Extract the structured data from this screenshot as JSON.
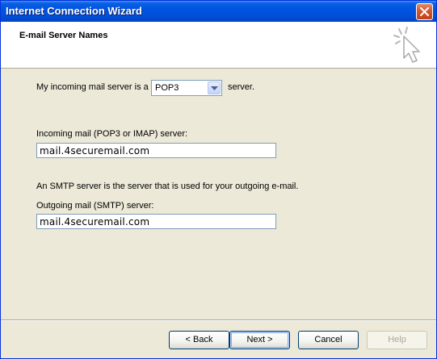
{
  "window": {
    "title": "Internet Connection Wizard",
    "close_icon": "close-icon"
  },
  "header": {
    "heading": "E-mail Server Names",
    "icon": "wizard-sparkle-cursor-icon"
  },
  "form": {
    "incoming_type_prefix": "My incoming mail server is a",
    "incoming_type_value": "POP3",
    "incoming_type_suffix": "server.",
    "incoming_label": "Incoming mail (POP3 or IMAP) server:",
    "incoming_value": "mail.4securemail.com",
    "smtp_note": "An SMTP server is the server that is used for your outgoing e-mail.",
    "outgoing_label": "Outgoing mail (SMTP) server:",
    "outgoing_value": "mail.4securemail.com"
  },
  "buttons": {
    "back": "< Back",
    "next": "Next >",
    "cancel": "Cancel",
    "help": "Help"
  }
}
